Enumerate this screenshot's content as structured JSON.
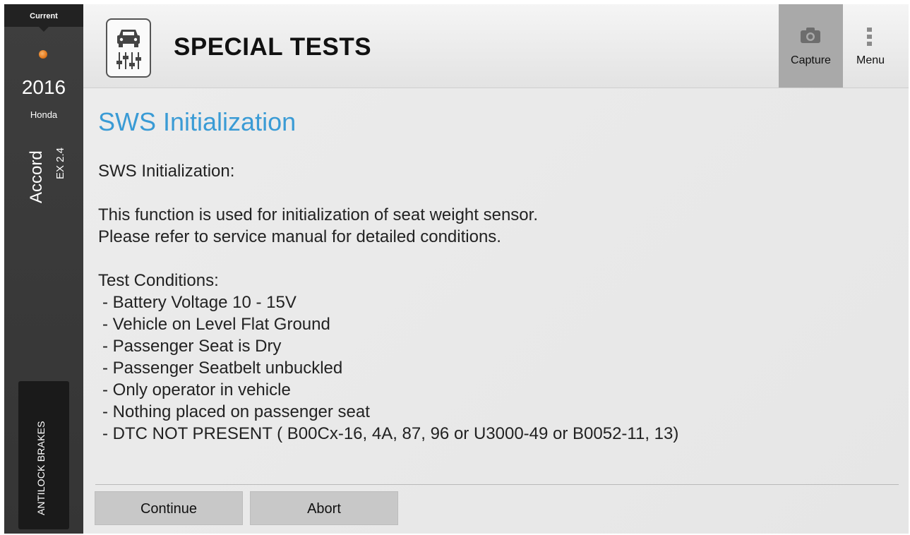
{
  "sidebar": {
    "current_label": "Current",
    "year": "2016",
    "make": "Honda",
    "model": "Accord",
    "trim": "EX 2.4",
    "system": "ANTILOCK BRAKES",
    "status_color": "#e67e22"
  },
  "header": {
    "title": "SPECIAL TESTS",
    "app_icon": "car-diagnostics-icon",
    "capture_label": "Capture",
    "capture_icon": "camera-icon",
    "menu_label": "Menu",
    "menu_icon": "vertical-dots-icon"
  },
  "content": {
    "section_title": "SWS Initialization",
    "intro_heading": "SWS Initialization:",
    "description_lines": [
      "This function is used for initialization of seat weight sensor.",
      "Please refer to service manual for detailed conditions."
    ],
    "conditions_heading": "Test Conditions:",
    "conditions": [
      "- Battery Voltage 10 - 15V",
      "- Vehicle on Level Flat Ground",
      "- Passenger Seat is Dry",
      "- Passenger Seatbelt unbuckled",
      "- Only operator in vehicle",
      "- Nothing placed on passenger seat",
      "- DTC NOT PRESENT ( B00Cx-16, 4A, 87, 96  or  U3000-49  or  B0052-11, 13)"
    ]
  },
  "actions": {
    "continue_label": "Continue",
    "abort_label": "Abort"
  },
  "colors": {
    "accent": "#3a9bd5",
    "sidebar_bg": "#3a3a3a",
    "capture_active_bg": "#a9a9a9"
  }
}
